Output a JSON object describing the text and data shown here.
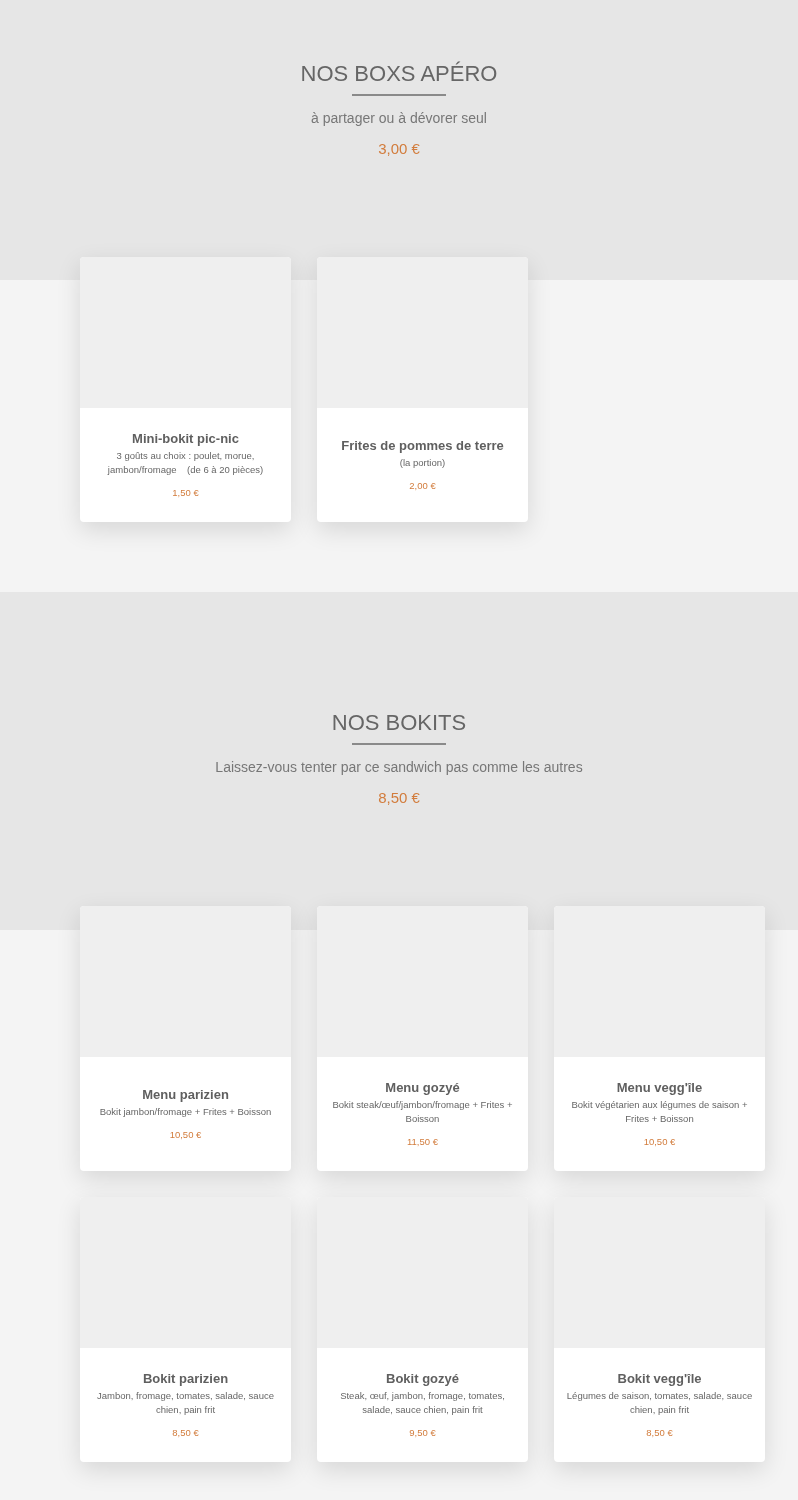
{
  "sections": [
    {
      "title": "NOS BOXS APÉRO",
      "subtitle": "à partager ou à dévorer seul",
      "price": "3,00 €",
      "cards": [
        {
          "kind": "picture",
          "name": "Mini-bokit pic-nic",
          "description": "3 goûts au choix : poulet, morue, jambon/fromage    (de 6 à 20 pièces)",
          "price": "1,50 €"
        },
        {
          "kind": "picture",
          "name": "Frites de pommes de terre",
          "description": "(la portion)",
          "price": "2,00 €"
        }
      ]
    },
    {
      "title": "NOS BOKITS",
      "subtitle": "Laissez-vous tenter par ce sandwich pas comme les autres",
      "price": "8,50 €",
      "cards": [
        {
          "kind": "picture",
          "name": "Menu parizien",
          "description": "Bokit jambon/fromage + Frites + Boisson",
          "price": "10,50 €"
        },
        {
          "kind": "picture",
          "name": "Menu gozyé",
          "description": "Bokit steak/œuf/jambon/fromage + Frites + Boisson",
          "price": "11,50 €"
        },
        {
          "kind": "picture",
          "name": "Menu vegg'île",
          "description": "Bokit végétarien aux légumes de saison + Frites + Boisson",
          "price": "10,50 €"
        },
        {
          "kind": "picture",
          "name": "Bokit parizien",
          "description": "Jambon, fromage, tomates, salade, sauce chien, pain frit",
          "price": "8,50 €"
        },
        {
          "kind": "picture",
          "name": "Bokit gozyé",
          "description": "Steak, œuf, jambon, fromage, tomates, salade, sauce chien, pain frit",
          "price": "9,50 €"
        },
        {
          "kind": "picture",
          "name": "Bokit vegg'île",
          "description": "Légumes de saison, tomates, salade, sauce chien, pain frit",
          "price": "8,50 €"
        }
      ]
    }
  ]
}
